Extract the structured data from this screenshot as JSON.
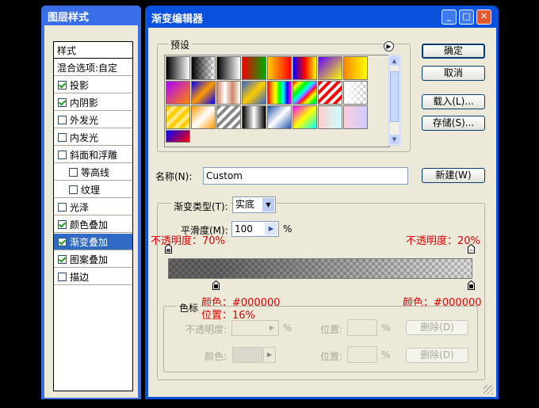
{
  "layer_panel": {
    "title": "图层样式",
    "items": [
      {
        "label": "样式",
        "check": false,
        "header": true
      },
      {
        "label": "混合选项:自定",
        "check": false,
        "header": true
      },
      {
        "label": "投影",
        "check": true
      },
      {
        "label": "内阴影",
        "check": true
      },
      {
        "label": "外发光",
        "check": false
      },
      {
        "label": "内发光",
        "check": false
      },
      {
        "label": "斜面和浮雕",
        "check": false
      },
      {
        "label": "等高线",
        "check": false,
        "indent": true
      },
      {
        "label": "纹理",
        "check": false,
        "indent": true
      },
      {
        "label": "光泽",
        "check": false
      },
      {
        "label": "颜色叠加",
        "check": true
      },
      {
        "label": "渐变叠加",
        "check": true,
        "selected": true
      },
      {
        "label": "图案叠加",
        "check": true
      },
      {
        "label": "描边",
        "check": false
      }
    ]
  },
  "dialog": {
    "title": "渐变编辑器",
    "presets_label": "预设",
    "ok": "确定",
    "cancel": "取消",
    "load": "载入(L)...",
    "save": "存储(S)...",
    "name_label": "名称(N):",
    "name_value": "Custom",
    "new": "新建(W)",
    "type_label": "渐变类型(T):",
    "type_value": "实底",
    "smooth_label": "平滑度(M):",
    "smooth_value": "100",
    "smooth_unit": "%",
    "stops_group": "色标",
    "opacity_label": "不透明度:",
    "pct": "%",
    "location_label": "位置:",
    "delete": "删除(D)",
    "color_label": "颜色:"
  },
  "annotations": {
    "opacity_left": "不透明度：70%",
    "opacity_right": "不透明度：20%",
    "color_left": "颜色：#000000",
    "position_left": "位置：16%",
    "color_right": "颜色：#000000"
  },
  "colors": {
    "accent": "#0a52de",
    "annotation": "#e00000"
  }
}
